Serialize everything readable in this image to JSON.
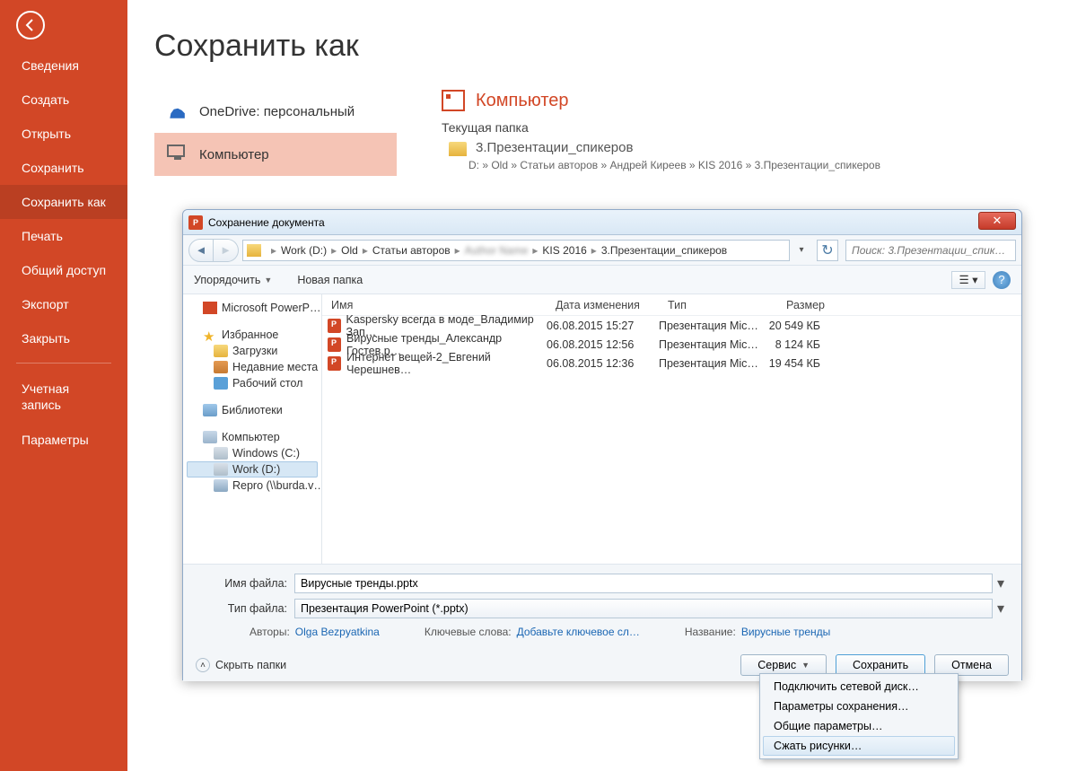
{
  "sidebar": {
    "items": [
      {
        "label": "Сведения"
      },
      {
        "label": "Создать"
      },
      {
        "label": "Открыть"
      },
      {
        "label": "Сохранить"
      },
      {
        "label": "Сохранить как",
        "active": true
      },
      {
        "label": "Печать"
      },
      {
        "label": "Общий доступ"
      },
      {
        "label": "Экспорт"
      },
      {
        "label": "Закрыть"
      }
    ],
    "account": "Учетная\nзапись",
    "options": "Параметры"
  },
  "page": {
    "title": "Сохранить как",
    "places": {
      "onedrive": "OneDrive: персональный",
      "computer": "Компьютер"
    },
    "right": {
      "heading": "Компьютер",
      "current_folder_label": "Текущая папка",
      "folder_name": "3.Презентации_спикеров",
      "folder_path": "D: » Old » Статьи авторов » Андрей Киреев » KIS 2016 » 3.Презентации_спикеров"
    }
  },
  "dialog": {
    "title": "Сохранение документа",
    "breadcrumb": [
      "Work (D:)",
      "Old",
      "Статьи авторов",
      "<blurred>",
      "KIS 2016",
      "3.Презентации_спикеров"
    ],
    "search_placeholder": "Поиск: 3.Презентации_спик…",
    "toolbar": {
      "organize": "Упорядочить",
      "new_folder": "Новая папка"
    },
    "tree": {
      "powerpoint": "Microsoft PowerP…",
      "favorites": "Избранное",
      "downloads": "Загрузки",
      "recent": "Недавние места",
      "desktop": "Рабочий стол",
      "libraries": "Библиотеки",
      "computer": "Компьютер",
      "drive_c": "Windows (C:)",
      "drive_d": "Work (D:)",
      "drive_repro": "Repro (\\\\burda.v…"
    },
    "columns": {
      "name": "Имя",
      "date": "Дата изменения",
      "type": "Тип",
      "size": "Размер"
    },
    "files": [
      {
        "name": "Kaspersky всегда в моде_Владимир Зап…",
        "date": "06.08.2015 15:27",
        "type": "Презентация Mic…",
        "size": "20 549 КБ"
      },
      {
        "name": "Вирусные тренды_Александр Гостев.p…",
        "date": "06.08.2015 12:56",
        "type": "Презентация Mic…",
        "size": "8 124 КБ"
      },
      {
        "name": "Интернет вещей-2_Евгений Черешнев…",
        "date": "06.08.2015 12:36",
        "type": "Презентация Mic…",
        "size": "19 454 КБ"
      }
    ],
    "filename_label": "Имя файла:",
    "filename_value": "Вирусные тренды.pptx",
    "filetype_label": "Тип файла:",
    "filetype_value": "Презентация PowerPoint (*.pptx)",
    "meta": {
      "authors_label": "Авторы:",
      "authors_value": "Olga Bezpyatkina",
      "keywords_label": "Ключевые слова:",
      "keywords_value": "Добавьте ключевое сл…",
      "title_label": "Название:",
      "title_value": "Вирусные тренды"
    },
    "hide_folders": "Скрыть папки",
    "buttons": {
      "service": "Сервис",
      "save": "Сохранить",
      "cancel": "Отмена"
    },
    "service_menu": [
      "Подключить сетевой диск…",
      "Параметры сохранения…",
      "Общие параметры…",
      "Сжать рисунки…"
    ]
  }
}
